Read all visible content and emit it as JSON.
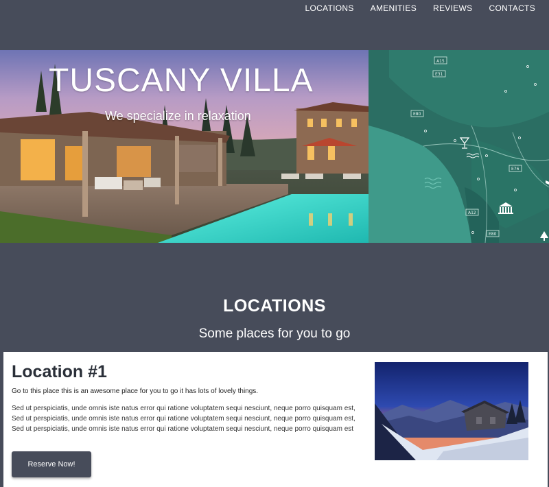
{
  "nav": {
    "items": [
      {
        "label": "LOCATIONS"
      },
      {
        "label": "AMENITIES"
      },
      {
        "label": "REVIEWS"
      },
      {
        "label": "CONTACTS"
      }
    ]
  },
  "hero": {
    "title": "TUSCANY VILLA",
    "subtitle": "We specialize in relaxation",
    "map_labels": [
      "A15",
      "E31",
      "E80",
      "E76",
      "A12",
      "E80"
    ]
  },
  "locations": {
    "title": "LOCATIONS",
    "subtitle": "Some places for you to go",
    "cards": [
      {
        "title": "Location #1",
        "lead": "Go to this place this is an awesome place for you to go it has lots of lovely things.",
        "body": "Sed ut perspiciatis, unde omnis iste natus error qui ratione voluptatem sequi nesciunt, neque porro quisquam est, Sed ut perspiciatis, unde omnis iste natus error qui ratione voluptatem sequi nesciunt, neque porro quisquam est, Sed ut perspiciatis, unde omnis iste natus error qui ratione voluptatem sequi nesciunt, neque porro quisquam est",
        "button_label": "Reserve Now!"
      }
    ]
  },
  "colors": {
    "background": "#474c5a",
    "map": "#2c7064",
    "card": "#ffffff",
    "button": "#474c5a"
  }
}
